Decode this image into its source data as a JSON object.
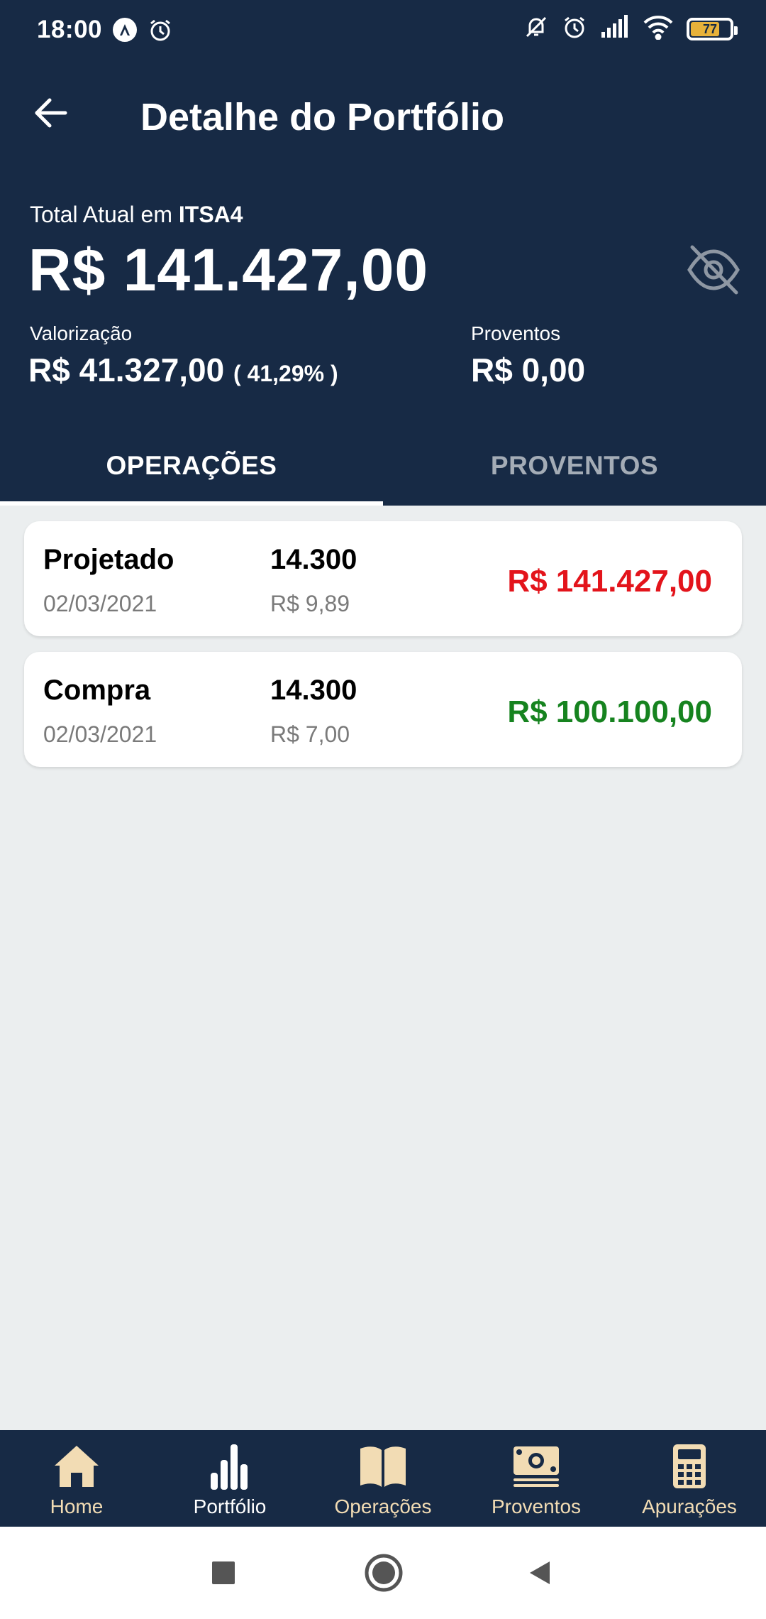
{
  "status_bar": {
    "time": "18:00",
    "battery_level": "77",
    "icons": [
      "navigation-icon",
      "alarm-icon",
      "mute-icon",
      "alarm-icon",
      "signal-icon",
      "wifi-icon",
      "battery-icon"
    ]
  },
  "app_bar": {
    "title": "Detalhe do Portfólio",
    "back_icon": "arrow-left-icon"
  },
  "summary": {
    "total_label_prefix": "Total Atual em ",
    "ticker": "ITSA4",
    "total_value": "R$ 141.427,00",
    "visibility_icon": "eye-off-icon",
    "valorizacao_label": "Valorização",
    "valorizacao_value": "R$ 41.327,00",
    "valorizacao_pct": "( 41,29% )",
    "proventos_label": "Proventos",
    "proventos_value": "R$ 0,00"
  },
  "tabs": [
    {
      "label": "OPERAÇÕES",
      "active": true
    },
    {
      "label": "PROVENTOS",
      "active": false
    }
  ],
  "operations": [
    {
      "type": "Projetado",
      "date": "02/03/2021",
      "quantity": "14.300",
      "unit_price": "R$ 9,89",
      "total": "R$ 141.427,00",
      "total_color": "#e3141b"
    },
    {
      "type": "Compra",
      "date": "02/03/2021",
      "quantity": "14.300",
      "unit_price": "R$ 7,00",
      "total": "R$ 100.100,00",
      "total_color": "#16831f"
    }
  ],
  "bottom_nav": [
    {
      "label": "Home",
      "icon": "home-icon",
      "active": false
    },
    {
      "label": "Portfólio",
      "icon": "bar-chart-icon",
      "active": true
    },
    {
      "label": "Operações",
      "icon": "book-icon",
      "active": false
    },
    {
      "label": "Proventos",
      "icon": "money-icon",
      "active": false
    },
    {
      "label": "Apurações",
      "icon": "calculator-icon",
      "active": false
    }
  ],
  "colors": {
    "header_bg": "#172a45",
    "page_bg": "#ebeeef",
    "nav_icon_color": "#f2dcb4",
    "loss_or_projected": "#e3141b",
    "gain": "#16831f"
  }
}
